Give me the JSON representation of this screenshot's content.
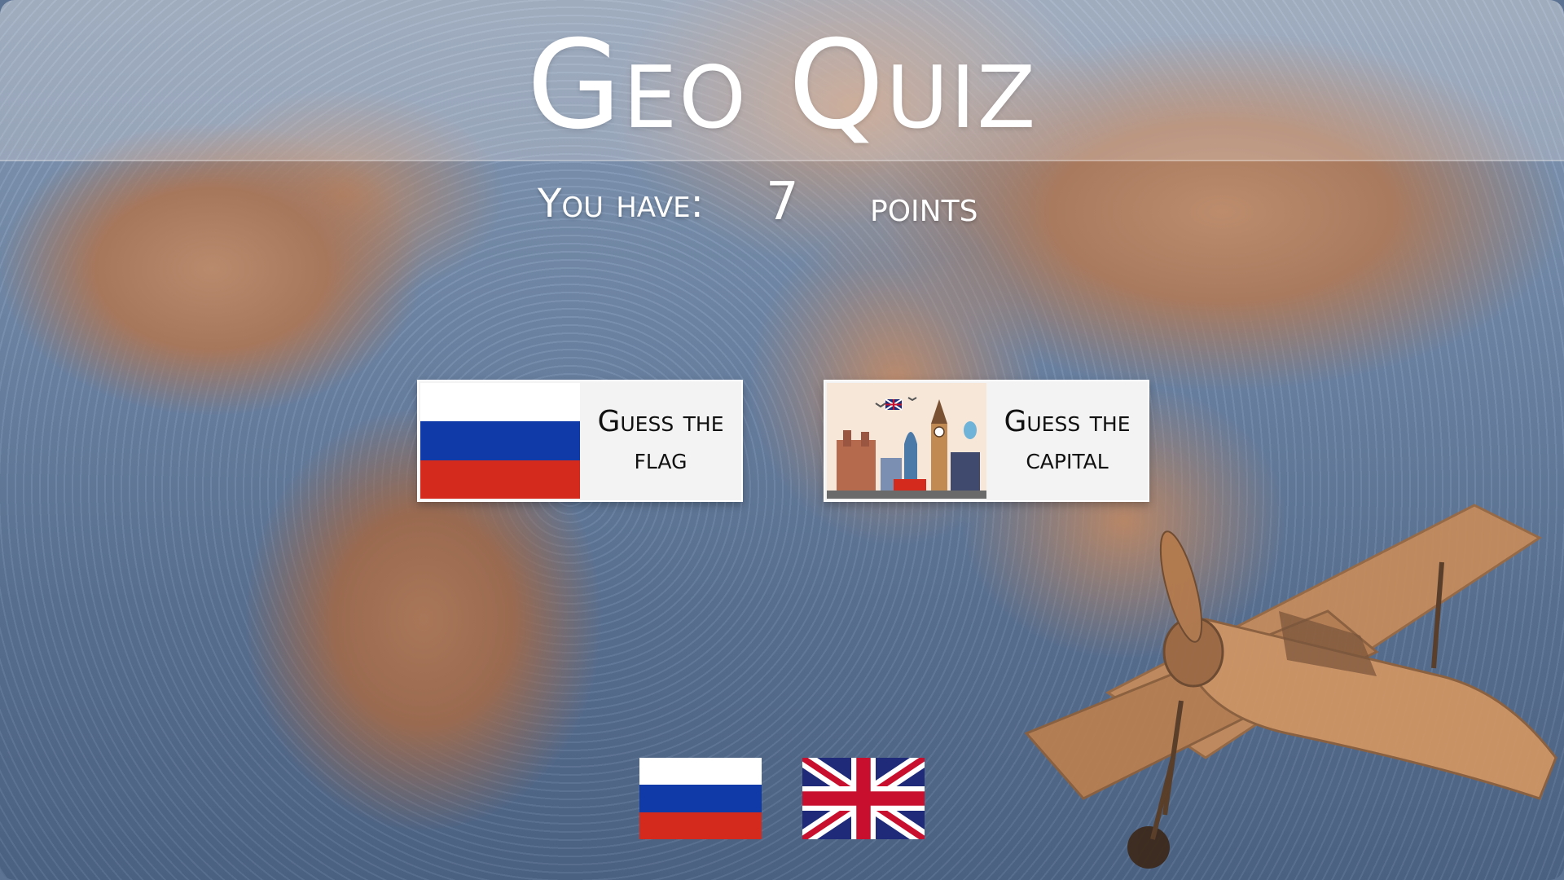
{
  "app": {
    "title": "Geo Quiz"
  },
  "score": {
    "label": "You have:",
    "value": "7",
    "unit": "points"
  },
  "modes": [
    {
      "label_line1": "Guess the",
      "label_line2": "flag",
      "icon": "russia-flag-icon"
    },
    {
      "label_line1": "Guess the",
      "label_line2": "capital",
      "icon": "london-landmarks-icon"
    }
  ],
  "languages": [
    {
      "code": "ru",
      "icon": "russia-flag-icon"
    },
    {
      "code": "en",
      "icon": "uk-flag-icon"
    }
  ],
  "colors": {
    "russia_white": "#ffffff",
    "russia_blue": "#0f3aa8",
    "russia_red": "#d42a1d",
    "uk_blue": "#1f2a78",
    "uk_red": "#c8102e",
    "button_bg": "#f3f3f3",
    "title_text": "#ffffff"
  }
}
